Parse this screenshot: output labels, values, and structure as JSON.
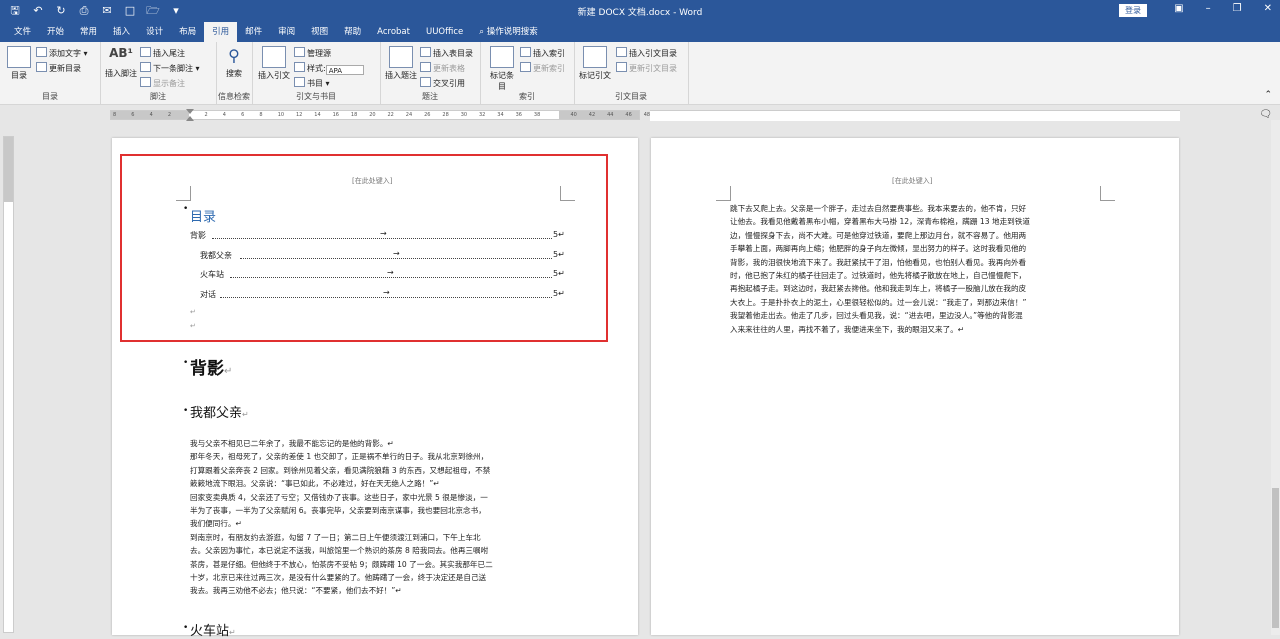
{
  "titlebar": {
    "document_title": "新建 DOCX 文档.docx  -  Word",
    "login_label": "登录"
  },
  "tabs": [
    "文件",
    "开始",
    "常用",
    "插入",
    "设计",
    "布局",
    "引用",
    "邮件",
    "审阅",
    "视图",
    "帮助",
    "Acrobat",
    "UUOffice",
    "操作说明搜索"
  ],
  "active_tab_index": 6,
  "ribbon": {
    "toc_group": {
      "label": "目录",
      "toc_button": "目录",
      "add_text": "添加文字",
      "update_toc": "更新目录"
    },
    "footnote_group": {
      "label": "脚注",
      "insert_footnote": "插入脚注",
      "insert_endnote": "插入尾注",
      "next_footnote": "下一条脚注",
      "show_notes": "显示备注",
      "ab_glyph": "AB¹"
    },
    "research_group": {
      "label": "信息检索",
      "search": "搜索"
    },
    "citation_group": {
      "label": "引文与书目",
      "insert_citation": "插入引文",
      "manage_sources": "管理源",
      "style_label": "样式:",
      "style_value": "APA",
      "bibliography": "书目"
    },
    "caption_group": {
      "label": "题注",
      "insert_caption": "插入题注",
      "insert_table_of_figures": "插入表目录",
      "update_table": "更新表格",
      "cross_reference": "交叉引用"
    },
    "index_group": {
      "label": "索引",
      "mark_entry": "标记条目",
      "insert_index": "插入索引",
      "update_index": "更新索引"
    },
    "authorities_group": {
      "label": "引文目录",
      "mark_citation": "标记引文",
      "insert_toa": "插入引文目录",
      "update_toa": "更新引文目录"
    }
  },
  "ruler_left": [
    "8",
    "6",
    "4",
    "2",
    "",
    "2",
    "4",
    "6",
    "8",
    "10",
    "12",
    "14",
    "16",
    "18",
    "20",
    "22",
    "24",
    "26",
    "28",
    "30",
    "32",
    "34",
    "36",
    "38",
    "",
    "40",
    "42",
    "44",
    "46",
    "48"
  ],
  "page1": {
    "header_placeholder": "[在此处键入]",
    "toc_title": "目录",
    "toc_entries": [
      {
        "text": "背影",
        "page": "5"
      },
      {
        "text": "我都父亲",
        "page": "5"
      },
      {
        "text": "火车站",
        "page": "5"
      },
      {
        "text": "对话",
        "page": "5"
      }
    ],
    "heading1": "背影",
    "heading2": "我都父亲",
    "body_lines": [
      "我与父亲不相见已二年余了，我最不能忘记的是他的背影。↵",
      "那年冬天，祖母死了，父亲的差使 1 也交卸了，正是祸不单行的日子。我从北京到徐州，",
      "打算跟着父亲奔丧 2 回家。到徐州见着父亲，看见满院狼藉 3 的东西，又想起祖母，不禁",
      "簌簌地流下眼泪。父亲说：“事已如此，不必难过，好在天无绝人之路！”↵",
      "回家变卖典质 4，父亲还了亏空；又借钱办了丧事。这些日子，家中光景 5 很是惨淡，一",
      "半为了丧事，一半为了父亲赋闲 6。丧事完毕，父亲要到南京谋事，我也要回北京念书，",
      "我们便同行。↵",
      "到南京时，有朋友约去游逛，勾留 7 了一日；第二日上午便须渡江到浦口，下午上车北",
      "去。父亲因为事忙，本已说定不送我，叫旅馆里一个熟识的茶房 8 陪我同去。他再三嘱咐",
      "茶房，甚是仔细。但他终于不放心，怕茶房不妥帖 9；颇踌躇 10 了一会。其实我那年已二",
      "十岁，北京已来往过两三次，是没有什么要紧的了。他踌躇了一会，终于决定还是自己送",
      "我去。我再三劝他不必去；他只说：“不要紧，他们去不好！”↵"
    ],
    "heading3": "火车站"
  },
  "page2": {
    "header_placeholder": "[在此处键入]",
    "body_lines": [
      "跳下去又爬上去。父亲是一个胖子，走过去自然要费事些。我本来要去的，他不肯，只好",
      "让他去。我看见他戴着黑布小帽，穿着黑布大马褂 12，深青布棉袍，蹒跚 13 地走到铁道",
      "边，慢慢探身下去，尚不大难。可是他穿过铁道，要爬上那边月台，就不容易了。他用两",
      "手攀着上面，两脚再向上缩；他肥胖的身子向左微倾，显出努力的样子。这时我看见他的",
      "背影，我的泪很快地流下来了。我赶紧拭干了泪，怕他看见，也怕别人看见。我再向外看",
      "时，他已抱了朱红的橘子往回走了。过铁道时，他先将橘子散放在地上，自己慢慢爬下，",
      "再抱起橘子走。到这边时，我赶紧去搀他。他和我走到车上，将橘子一股脑儿放在我的皮",
      "大衣上。于是扑扑衣上的泥土，心里很轻松似的。过一会儿说：“我走了，到那边来信！”",
      "我望着他走出去。他走了几步，回过头看见我，说：“进去吧，里边没人。”等他的背影混",
      "入来来往往的人里，再找不着了，我便进来坐下，我的眼泪又来了。↵"
    ]
  }
}
